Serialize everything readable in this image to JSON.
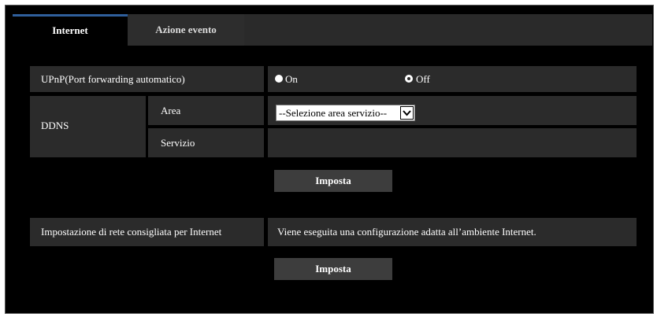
{
  "tabs": [
    {
      "label": "Internet",
      "active": true
    },
    {
      "label": "Azione evento",
      "active": false
    }
  ],
  "upnp": {
    "label": "UPnP(Port forwarding automatico)",
    "option_on": "On",
    "option_off": "Off",
    "selected": "Off"
  },
  "ddns": {
    "label": "DDNS",
    "area_label": "Area",
    "area_value": "--Selezione area servizio--",
    "service_label": "Servizio",
    "service_value": ""
  },
  "buttons": {
    "set1": "Imposta",
    "set2": "Imposta"
  },
  "recommended": {
    "label": "Impostazione di rete consigliata per Internet",
    "description": "Viene eseguita una configurazione adatta all’ambiente Internet."
  },
  "colors": {
    "background": "#000000",
    "row": "#2b2b2b",
    "tab_accent": "#2f5f9c",
    "button": "#3d3d3d"
  }
}
